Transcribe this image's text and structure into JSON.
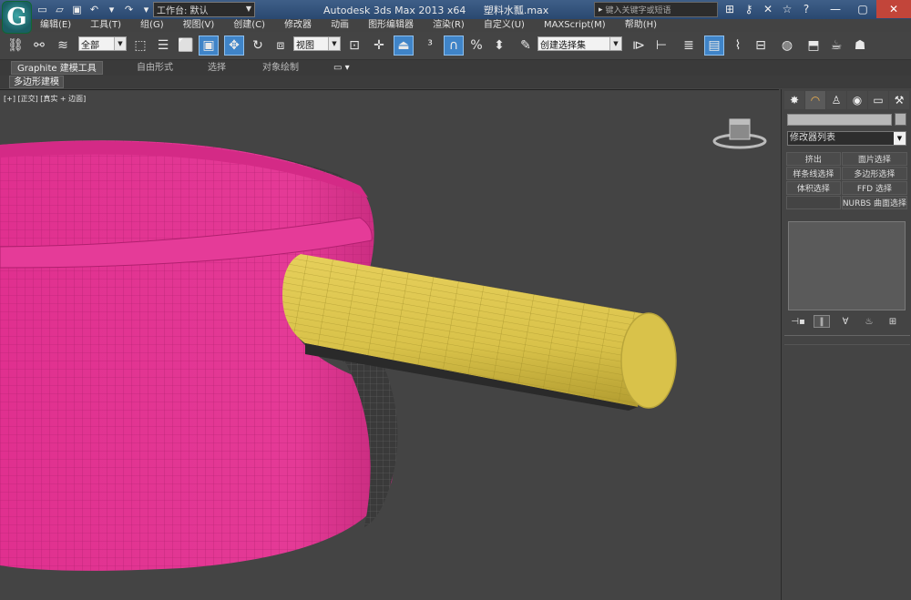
{
  "titlebar": {
    "app_title": "Autodesk 3ds Max  2013 x64",
    "file_name": "塑料水瓢.max",
    "workspace_label": "工作台: 默认",
    "search_placeholder": "键入关键字或短语"
  },
  "menu": [
    "编辑(E)",
    "工具(T)",
    "组(G)",
    "视图(V)",
    "创建(C)",
    "修改器",
    "动画",
    "图形编辑器",
    "渲染(R)",
    "自定义(U)",
    "MAXScript(M)",
    "帮助(H)"
  ],
  "toolbar": {
    "selection_filter": "全部",
    "reference_coord": "视图",
    "named_selection": "创建选择集"
  },
  "ribbon": {
    "tabs": [
      "Graphite 建模工具",
      "自由形式",
      "选择",
      "对象绘制"
    ],
    "subtab": "多边形建模"
  },
  "viewport": {
    "label": "[+] [正交] [真实 + 边面]",
    "colors": {
      "bowl": "#e0308f",
      "handle": "#d9c24a"
    }
  },
  "command_panel": {
    "modifier_list": "修改器列表",
    "buttons": [
      "挤出",
      "面片选择",
      "样条线选择",
      "多边形选择",
      "体积选择",
      "FFD 选择",
      "",
      "NURBS 曲面选择"
    ]
  }
}
